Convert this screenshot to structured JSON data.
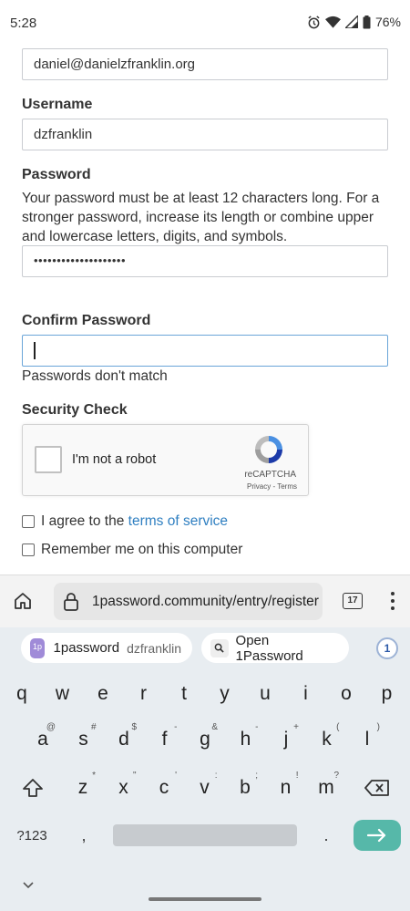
{
  "status": {
    "time": "5:28",
    "battery": "76%",
    "icons": [
      "alarm-icon",
      "wifi-icon",
      "signal-icon",
      "battery-icon"
    ]
  },
  "form": {
    "email_value": "daniel@danielzfranklin.org",
    "username_label": "Username",
    "username_value": "dzfranklin",
    "password_label": "Password",
    "password_help": "Your password must be at least 12 characters long. For a stronger password, increase its length or combine upper and lowercase letters, digits, and symbols.",
    "password_value": "••••••••••••••••••••",
    "confirm_label": "Confirm Password",
    "confirm_value": "",
    "confirm_error": "Passwords don't match",
    "security_label": "Security Check",
    "recaptcha": {
      "checkbox_label": "I'm not a robot",
      "brand": "reCAPTCHA",
      "links": "Privacy - Terms"
    },
    "agree_prefix": "I agree to the ",
    "agree_link": "terms of service",
    "remember_label": "Remember me on this computer"
  },
  "browser": {
    "url": "1password.community/entry/register",
    "tab_count": "17"
  },
  "keyboard": {
    "suggestions": {
      "account_name": "1password",
      "account_user": "dzfranklin",
      "open_label": "Open 1Password"
    },
    "row1": [
      {
        "k": "q",
        "h": ""
      },
      {
        "k": "w",
        "h": ""
      },
      {
        "k": "e",
        "h": ""
      },
      {
        "k": "r",
        "h": ""
      },
      {
        "k": "t",
        "h": ""
      },
      {
        "k": "y",
        "h": ""
      },
      {
        "k": "u",
        "h": ""
      },
      {
        "k": "i",
        "h": ""
      },
      {
        "k": "o",
        "h": ""
      },
      {
        "k": "p",
        "h": ""
      }
    ],
    "row2": [
      {
        "k": "a",
        "h": "@"
      },
      {
        "k": "s",
        "h": "#"
      },
      {
        "k": "d",
        "h": "$"
      },
      {
        "k": "f",
        "h": "-"
      },
      {
        "k": "g",
        "h": "&"
      },
      {
        "k": "h",
        "h": "-"
      },
      {
        "k": "j",
        "h": "+"
      },
      {
        "k": "k",
        "h": "("
      },
      {
        "k": "l",
        "h": ")"
      }
    ],
    "row3": [
      {
        "k": "z",
        "h": "*"
      },
      {
        "k": "x",
        "h": "\""
      },
      {
        "k": "c",
        "h": "'"
      },
      {
        "k": "v",
        "h": ":"
      },
      {
        "k": "b",
        "h": ";"
      },
      {
        "k": "n",
        "h": "!"
      },
      {
        "k": "m",
        "h": "?"
      }
    ],
    "symbols_label": "?123",
    "comma": ",",
    "period": "."
  },
  "colors": {
    "link": "#2f7fc1",
    "enter_key": "#56b8a9",
    "focus_border": "#6aa5d8"
  }
}
